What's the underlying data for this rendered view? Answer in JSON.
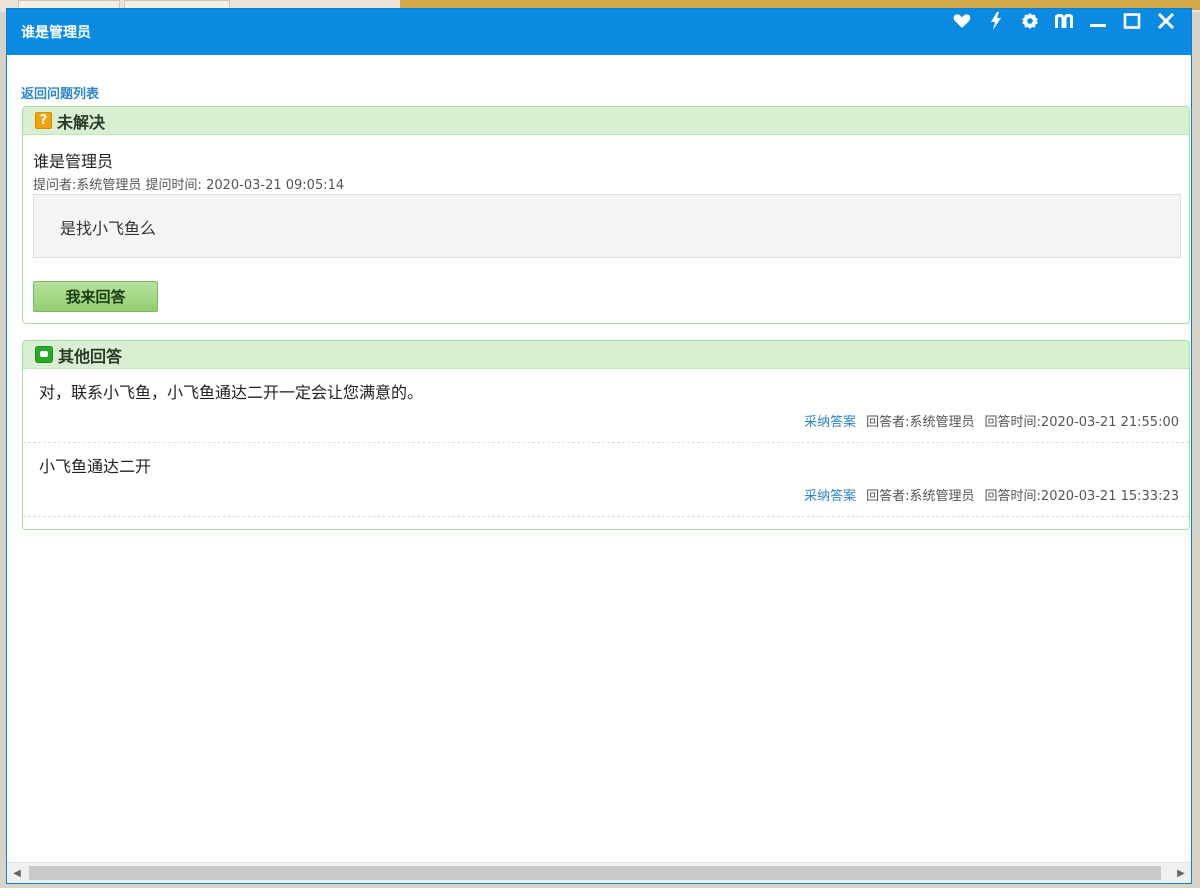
{
  "window": {
    "title": "谁是管理员",
    "controls": [
      {
        "name": "heart-icon"
      },
      {
        "name": "lightning-icon"
      },
      {
        "name": "gear-icon"
      },
      {
        "name": "book-icon"
      },
      {
        "name": "minimize-icon"
      },
      {
        "name": "maximize-icon"
      },
      {
        "name": "close-icon"
      }
    ]
  },
  "nav": {
    "back_label": "返回问题列表"
  },
  "question": {
    "status": "未解决",
    "title": "谁是管理员",
    "asker_label": "提问者:",
    "asker": "系统管理员",
    "time_label": "提问时间:",
    "time": "2020-03-21 09:05:14",
    "body": "是找小飞鱼么",
    "answer_button": "我来回答"
  },
  "other_answers": {
    "heading": "其他回答",
    "items": [
      {
        "text": "对，联系小飞鱼，小飞鱼通达二开一定会让您满意的。",
        "adopt_label": "采纳答案",
        "responder_label": "回答者:",
        "responder": "系统管理员",
        "time_label": "回答时间:",
        "time": "2020-03-21 21:55:00"
      },
      {
        "text": "小飞鱼通达二开",
        "adopt_label": "采纳答案",
        "responder_label": "回答者:",
        "responder": "系统管理员",
        "time_label": "回答时间:",
        "time": "2020-03-21 15:33:23"
      }
    ]
  },
  "colors": {
    "titlebar": "#0a8ae0",
    "panel_header": "#d8f0d1",
    "panel_border": "#a9dea0",
    "link": "#2f86c9",
    "button": "#a6d98a"
  }
}
